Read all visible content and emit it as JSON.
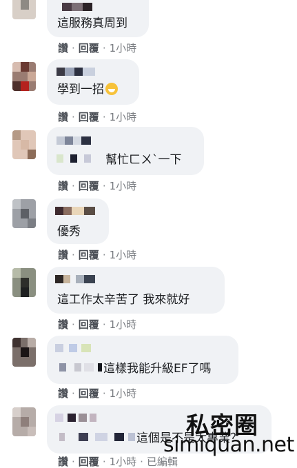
{
  "comments": [
    {
      "text": "這服務真周到",
      "actions": {
        "like": "讚",
        "reply": "回覆",
        "time": "1小時",
        "edited": ""
      }
    },
    {
      "text": "學到一招",
      "emoji": "grinning-sweat-emoji",
      "actions": {
        "like": "讚",
        "reply": "回覆",
        "time": "1小時",
        "edited": ""
      }
    },
    {
      "text": "幫忙ㄈㄨˋ一下",
      "actions": {
        "like": "讚",
        "reply": "回覆",
        "time": "1小時",
        "edited": ""
      }
    },
    {
      "text": "優秀",
      "actions": {
        "like": "讚",
        "reply": "回覆",
        "time": "1小時",
        "edited": ""
      }
    },
    {
      "text": "這工作太辛苦了 我來就好",
      "actions": {
        "like": "讚",
        "reply": "回覆",
        "time": "1小時",
        "edited": ""
      }
    },
    {
      "text": "這樣我能升級EF了嗎",
      "actions": {
        "like": "讚",
        "reply": "回覆",
        "time": "1小時",
        "edited": ""
      }
    },
    {
      "text": "這個是不是太專業？",
      "actions": {
        "like": "讚",
        "reply": "回覆",
        "time": "1小時",
        "edited": "已編輯"
      }
    }
  ],
  "separator": "·",
  "watermark": {
    "chinese": "私密圈",
    "english": "simiquan.net"
  }
}
